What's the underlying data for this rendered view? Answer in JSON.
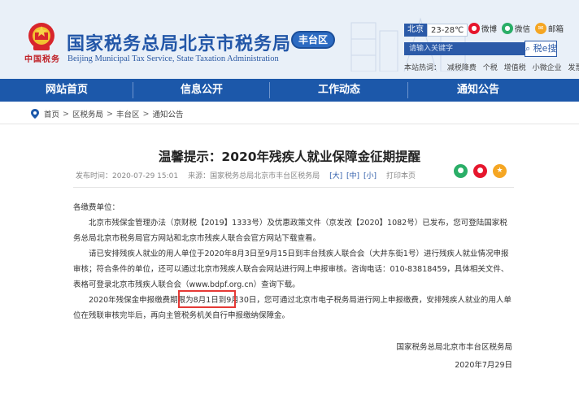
{
  "header": {
    "emblem_text": "中国税务",
    "title": "国家税务总局北京市税务局",
    "subtitle": "Beijing Municipal Tax Service, State Taxation Administration",
    "district": "丰台区",
    "weather": {
      "city": "北京",
      "temp": "23-28℃"
    },
    "social": [
      {
        "label": "微博",
        "icon": "weibo-icon",
        "color": "#e6162d"
      },
      {
        "label": "微信",
        "icon": "wechat-icon",
        "color": "#2aae67"
      },
      {
        "label": "邮箱",
        "icon": "mail-icon",
        "color": "#f5a623"
      }
    ],
    "search": {
      "placeholder": "请输入关键字",
      "button_label": "税e搜"
    },
    "hotwords_label": "本站热词：",
    "hotwords": [
      "减税降费",
      "个税",
      "增值税",
      "小微企业",
      "发票"
    ]
  },
  "nav": [
    "网站首页",
    "信息公开",
    "工作动态",
    "通知公告"
  ],
  "breadcrumb": [
    "首页",
    "区税务局",
    "丰台区",
    "通知公告"
  ],
  "article": {
    "title": "温馨提示：2020年残疾人就业保障金征期提醒",
    "publish_time": "发布时间：2020-07-29 15:01",
    "source": "来源：国家税务总局北京市丰台区税务局",
    "font_sizes": [
      "[大]",
      "[中]",
      "[小]"
    ],
    "print": "打印本页",
    "salutation": "各缴费单位：",
    "paragraphs": [
      "北京市残保金管理办法（京财税【2019】1333号）及优惠政策文件（京发改【2020】1082号）已发布，您可登陆国家税务总局北京市税务局官方网站和北京市残疾人联合会官方网站下载查看。",
      "请已安排残疾人就业的用人单位于2020年8月3日至9月15日到丰台残疾人联合会（大井东街1号）进行残疾人就业情况申报审核；符合条件的单位，还可以通过北京市残疾人联合会网站进行网上申报审核。咨询电话：010-83818459，具体相关文件、表格可登录北京市残疾人联合会（www.bdpf.org.cn）查询下载。",
      "2020年残保金申报缴费期限为8月1日到9月30日，您可通过北京市电子税务局进行网上申报缴费，安排残疾人就业的用人单位在残联审核完毕后，再向主管税务机关自行申报缴纳保障金。"
    ],
    "signature": "国家税务总局北京市丰台区税务局",
    "date": "2020年7月29日"
  },
  "share": [
    {
      "icon": "wechat-share-icon",
      "color": "#2aae67"
    },
    {
      "icon": "weibo-share-icon",
      "color": "#e6162d"
    },
    {
      "icon": "favorite-icon",
      "color": "#f5a623"
    }
  ]
}
